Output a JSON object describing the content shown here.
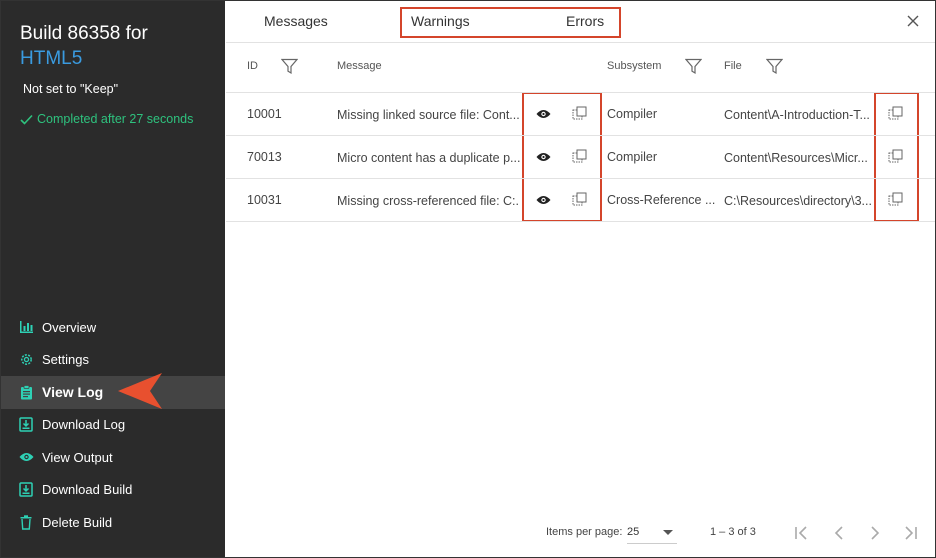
{
  "sidebar": {
    "build_title": "Build 86358 for",
    "target": "HTML5",
    "keep_status": "Not set to \"Keep\"",
    "completed": "Completed after 27 seconds",
    "items": [
      {
        "label": "Overview",
        "icon": "bar-chart-icon"
      },
      {
        "label": "Settings",
        "icon": "gear-icon"
      },
      {
        "label": "View Log",
        "icon": "clipboard-icon",
        "active": true
      },
      {
        "label": "Download Log",
        "icon": "download-icon"
      },
      {
        "label": "View Output",
        "icon": "eye-icon"
      },
      {
        "label": "Download Build",
        "icon": "download-icon"
      },
      {
        "label": "Delete Build",
        "icon": "trash-icon"
      }
    ]
  },
  "tabs": {
    "messages": "Messages",
    "warnings": "Warnings",
    "errors": "Errors"
  },
  "table": {
    "headers": {
      "id": "ID",
      "message": "Message",
      "subsystem": "Subsystem",
      "file": "File"
    },
    "rows": [
      {
        "id": "10001",
        "message": "Missing linked source file: Cont...",
        "subsystem": "Compiler",
        "file": "Content\\A-Introduction-T..."
      },
      {
        "id": "70013",
        "message": "Micro content has a duplicate p...",
        "subsystem": "Compiler",
        "file": "Content\\Resources\\Micr..."
      },
      {
        "id": "10031",
        "message": "Missing cross-referenced file: C:...",
        "subsystem": "Cross-Reference ...",
        "file": "C:\\Resources\\directory\\3..."
      }
    ]
  },
  "pagination": {
    "items_per_page_label": "Items per page:",
    "items_per_page_value": "25",
    "range": "1 – 3 of 3"
  },
  "colors": {
    "sidebar_bg": "#2b2b2b",
    "accent_teal": "#2ed1b5",
    "completed_green": "#2ec27e",
    "target_blue": "#3a9be0",
    "highlight_red": "#d4452b",
    "arrow_orange": "#e8502f"
  }
}
